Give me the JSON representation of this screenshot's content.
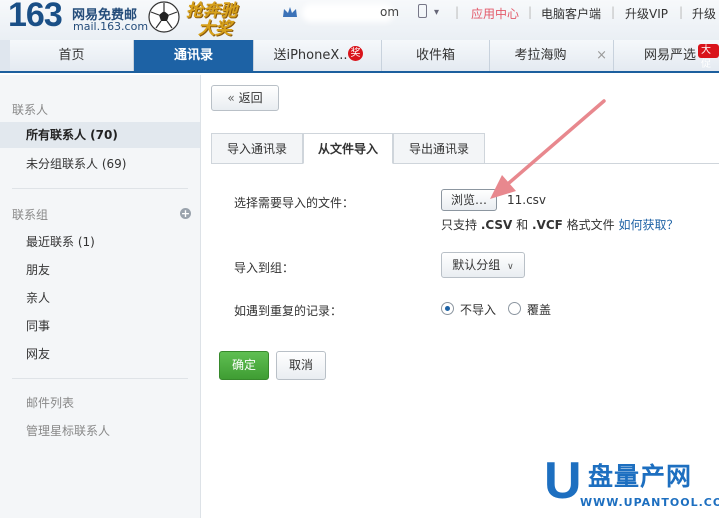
{
  "header": {
    "logo_number": "163",
    "logo_text": "网易免费邮",
    "logo_domain": "mail.163.com",
    "promo_line1": "抢奔驰",
    "promo_line2": "大奖",
    "user_suffix": "om",
    "links": [
      "应用中心",
      "电脑客户端",
      "升级VIP",
      "升级"
    ],
    "accent_link_color": "#e35a6a"
  },
  "tabs": [
    {
      "label": "首页",
      "active": false
    },
    {
      "label": "通讯录",
      "active": true
    },
    {
      "label": "送iPhoneX..",
      "badge": "奖",
      "active": false
    },
    {
      "label": "收件箱",
      "active": false
    },
    {
      "label": "考拉海购",
      "close": "×",
      "active": false
    },
    {
      "label": "网易严选",
      "badge": "大促",
      "active": false
    }
  ],
  "sidebar": {
    "contacts_heading": "联系人",
    "contact_items": [
      {
        "label": "所有联系人 (70)",
        "active": true
      },
      {
        "label": "未分组联系人 (69)",
        "active": false
      }
    ],
    "groups_heading": "联系组",
    "add_group_icon": "+",
    "group_items": [
      "最近联系 (1)",
      "朋友",
      "亲人",
      "同事",
      "网友"
    ],
    "extra_items": [
      "邮件列表",
      "管理星标联系人"
    ]
  },
  "main": {
    "back_label": "返回",
    "back_icon": "«",
    "subtabs": [
      {
        "label": "导入通讯录",
        "active": false
      },
      {
        "label": "从文件导入",
        "active": true
      },
      {
        "label": "导出通讯录",
        "active": false
      }
    ],
    "file_label": "选择需要导入的文件：",
    "browse_label": "浏览…",
    "file_name": "11.csv",
    "hint_prefix": "只支持 ",
    "hint_csv": ".CSV",
    "hint_and": " 和 ",
    "hint_vcf": ".VCF",
    "hint_suffix": " 格式文件 ",
    "hint_link": "如何获取？",
    "group_label": "导入到组：",
    "group_value": "默认分组",
    "dup_label": "如遇到重复的记录：",
    "dup_options": [
      {
        "label": "不导入",
        "checked": true
      },
      {
        "label": "覆盖",
        "checked": false
      }
    ],
    "ok_label": "确定",
    "cancel_label": "取消"
  },
  "watermark": {
    "letter": "U",
    "cn": "盘量产网",
    "en": "WWW.UPANTOOL.COM"
  },
  "colors": {
    "brand_blue": "#1d62a5",
    "ok_green": "#4aa83d",
    "arrow_pink": "#e8888e",
    "badge_red": "#d9141b"
  }
}
